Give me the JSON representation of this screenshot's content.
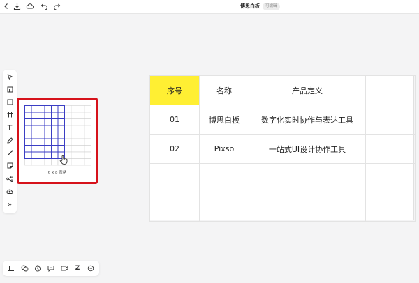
{
  "topbar": {
    "title": "博思白板",
    "badge": "可编辑",
    "icons": [
      "back-icon",
      "download-icon",
      "cloud-icon",
      "undo-icon",
      "redo-icon"
    ]
  },
  "left_toolbar": {
    "tools": [
      "select-icon",
      "frame-icon",
      "shape-icon",
      "crop-frame-icon",
      "text-icon",
      "pen-icon",
      "line-icon",
      "sticky-note-icon",
      "share-icon",
      "upload-icon",
      "more-icon"
    ],
    "text_tool_label": "T",
    "more_label": "»"
  },
  "table_picker": {
    "label": "6 x 8 表格",
    "columns": 10,
    "rows": 9,
    "selected_columns": 6,
    "selected_rows": 8,
    "highlight_color": "#3b3ec4"
  },
  "table": {
    "header": [
      "序号",
      "名称",
      "产品定义",
      ""
    ],
    "rows": [
      [
        "01",
        "博思白板",
        "数字化实时协作与表达工具",
        ""
      ],
      [
        "02",
        "Pixso",
        "一站式UI设计协作工具",
        ""
      ],
      [
        "",
        "",
        "",
        ""
      ],
      [
        "",
        "",
        "",
        ""
      ]
    ],
    "header_highlight_color": "#ffef33"
  },
  "bottom_toolbar": {
    "icons": [
      "layout-icon",
      "comment-icon",
      "timer-icon",
      "chat-icon",
      "video-icon",
      "z-icon",
      "more-circle-icon"
    ],
    "z_label": "Z"
  },
  "colors": {
    "selection_border": "#d6121b"
  }
}
